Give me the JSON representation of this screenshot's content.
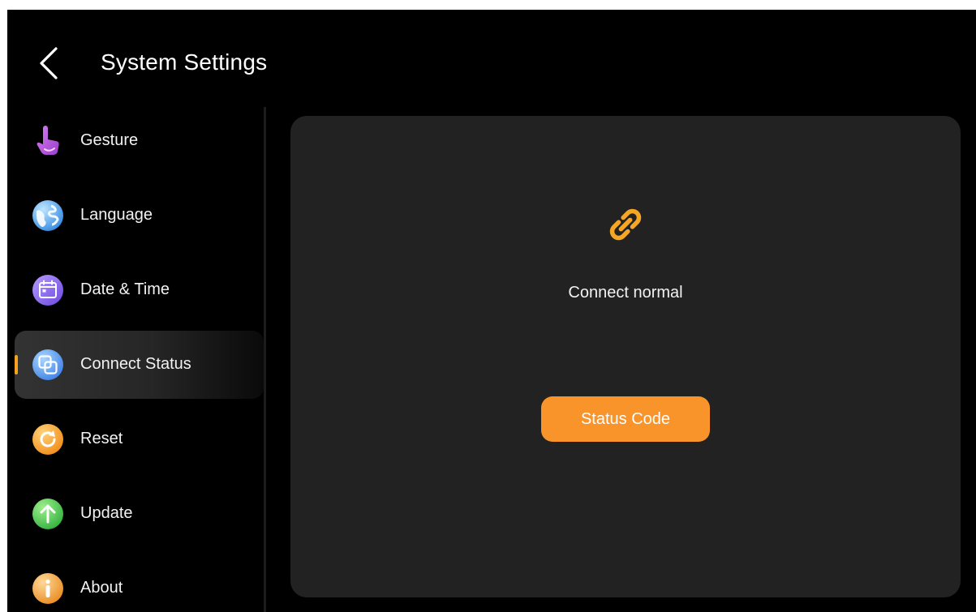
{
  "header": {
    "title": "System Settings",
    "back_icon": "chevron-left-icon"
  },
  "sidebar": {
    "items": [
      {
        "label": "Gesture",
        "icon": "gesture-hand-icon",
        "active": false
      },
      {
        "label": "Language",
        "icon": "globe-icon",
        "active": false
      },
      {
        "label": "Date & Time",
        "icon": "calendar-icon",
        "active": false
      },
      {
        "label": "Connect Status",
        "icon": "connect-status-icon",
        "active": true
      },
      {
        "label": "Reset",
        "icon": "reset-icon",
        "active": false
      },
      {
        "label": "Update",
        "icon": "update-arrow-icon",
        "active": false
      },
      {
        "label": "About",
        "icon": "info-icon",
        "active": false
      }
    ]
  },
  "main": {
    "status_icon": "link-icon",
    "status_text": "Connect normal",
    "status_code_button": "Status Code"
  },
  "colors": {
    "background": "#000000",
    "panel": "#222222",
    "accent_orange": "#f8942a",
    "link_icon": "#f5a623",
    "active_marker": "#f6a21e"
  }
}
